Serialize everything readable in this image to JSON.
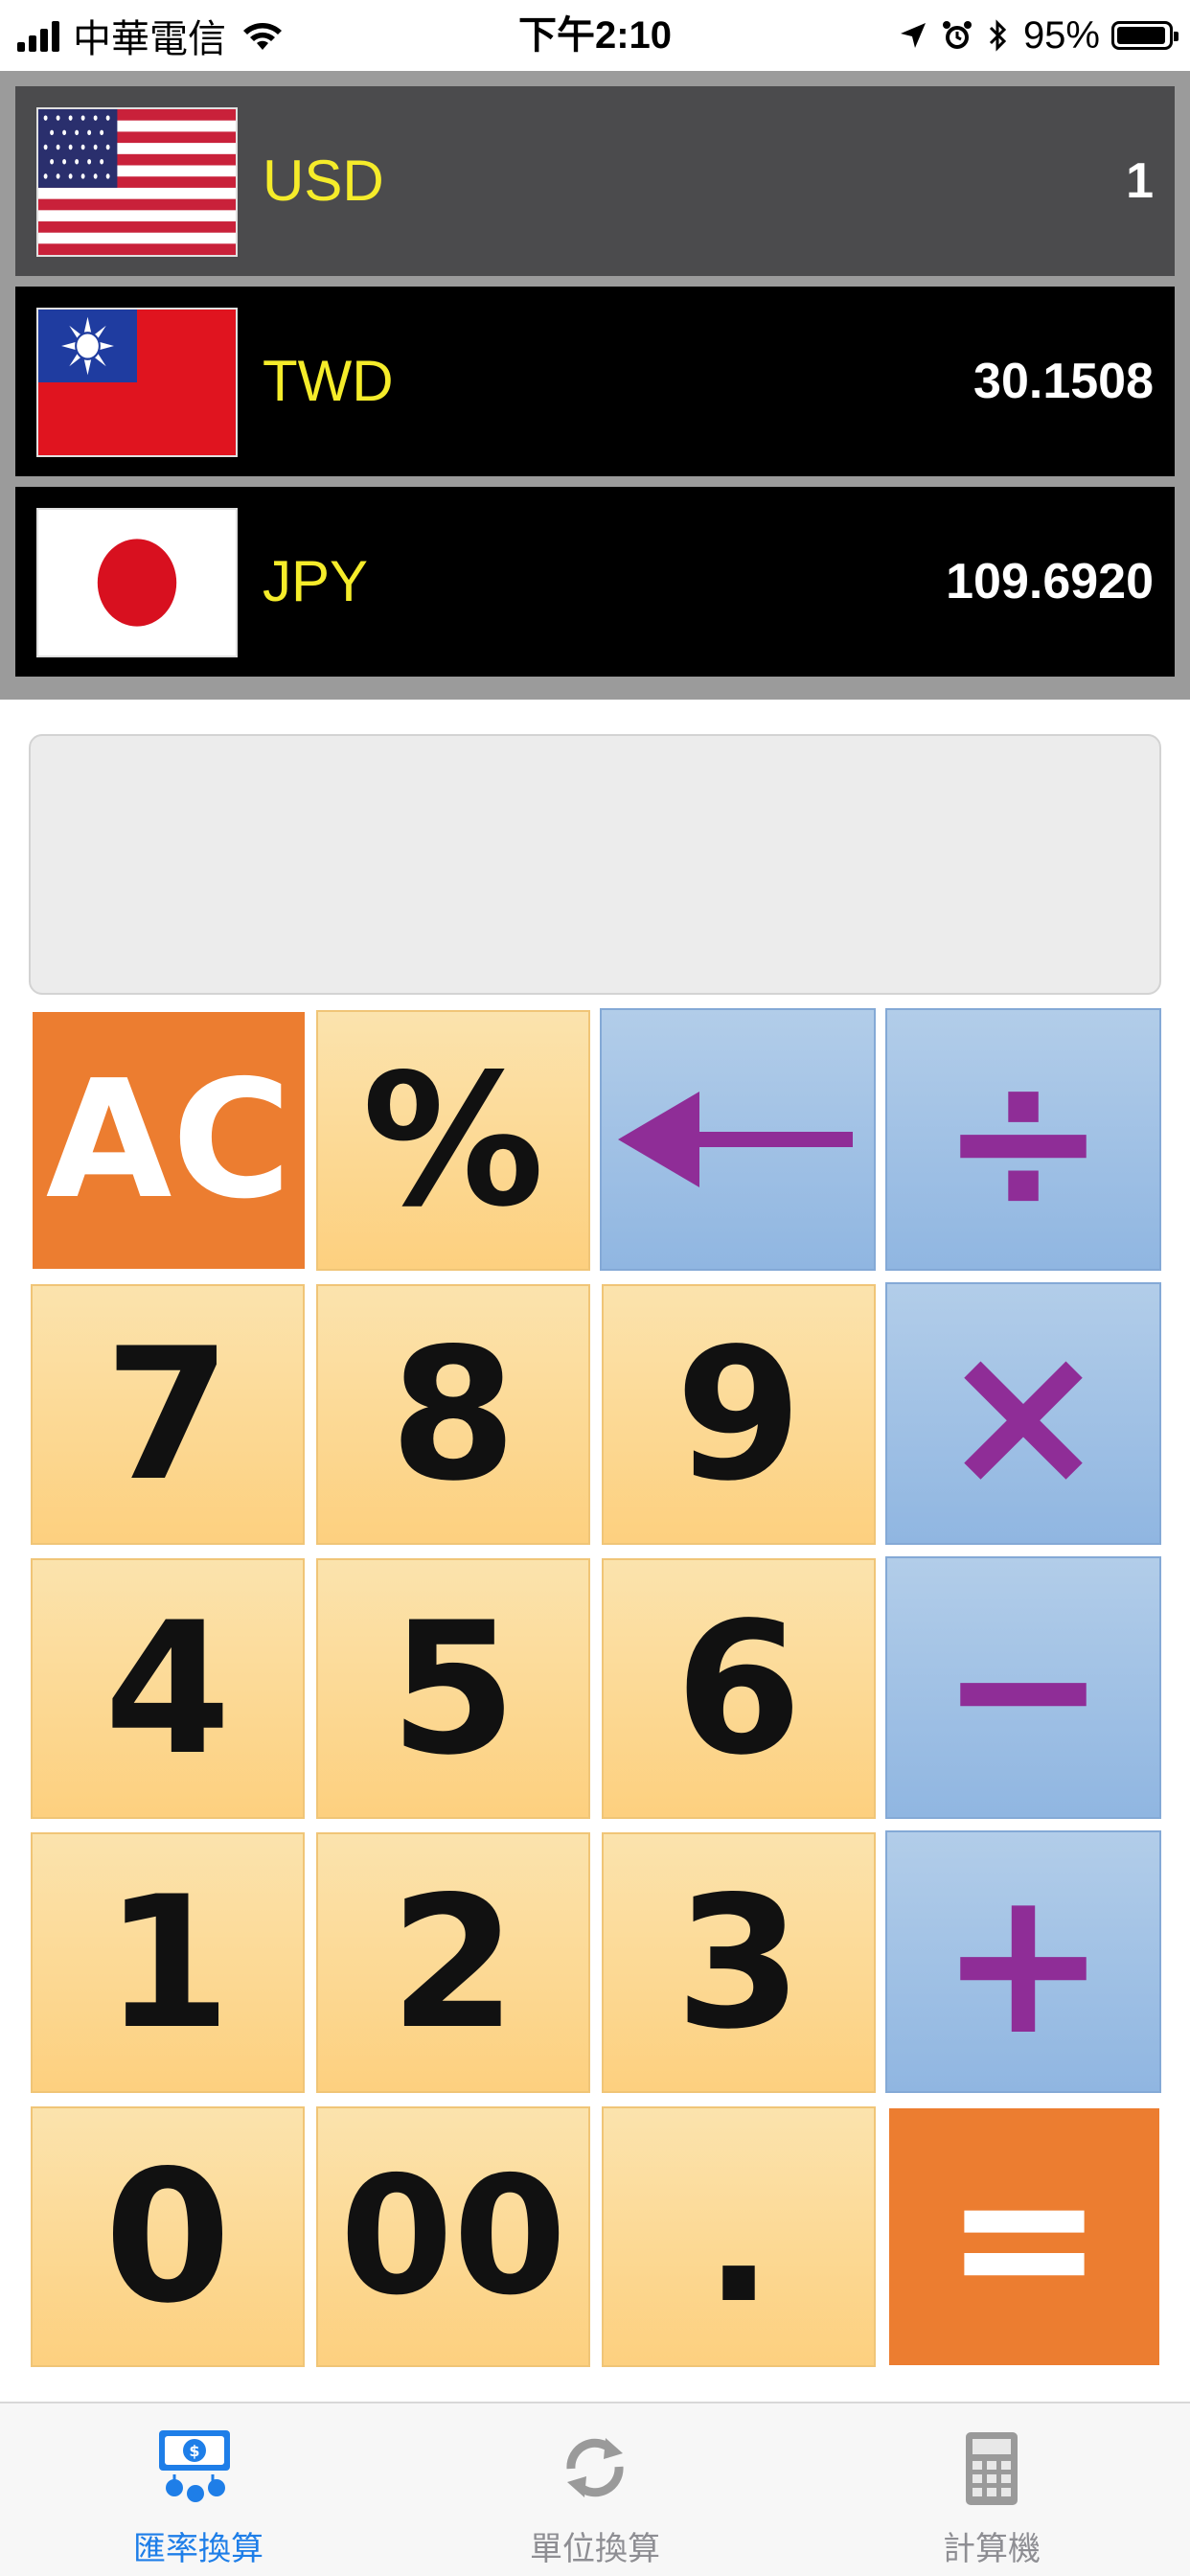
{
  "status_bar": {
    "carrier": "中華電信",
    "time": "下午2:10",
    "battery": "95%"
  },
  "currencies": [
    {
      "code": "USD",
      "rate": "1",
      "flag": "us-flag",
      "selected": true
    },
    {
      "code": "TWD",
      "rate": "30.1508",
      "flag": "taiwan-flag",
      "selected": false
    },
    {
      "code": "JPY",
      "rate": "109.6920",
      "flag": "japan-flag",
      "selected": false
    }
  ],
  "display": {
    "value": ""
  },
  "keypad": {
    "ac": "AC",
    "percent": "%",
    "backspace_icon": "arrow-left-icon",
    "divide": "÷",
    "seven": "7",
    "eight": "8",
    "nine": "9",
    "multiply": "×",
    "four": "4",
    "five": "5",
    "six": "6",
    "minus": "−",
    "one": "1",
    "two": "2",
    "three": "3",
    "plus": "+",
    "zero": "0",
    "double_zero": "00",
    "dot": ".",
    "equals": "="
  },
  "tabs": [
    {
      "label": "匯率換算",
      "icon": "currency-exchange-icon",
      "active": true
    },
    {
      "label": "單位換算",
      "icon": "refresh-icon",
      "active": false
    },
    {
      "label": "計算機",
      "icon": "calculator-icon",
      "active": false
    }
  ],
  "colors": {
    "accent_orange": "#ec7d30",
    "currency_code_yellow": "#f5ec2a",
    "operator_purple": "#8f2d97",
    "tab_active_blue": "#1e7ee8"
  }
}
